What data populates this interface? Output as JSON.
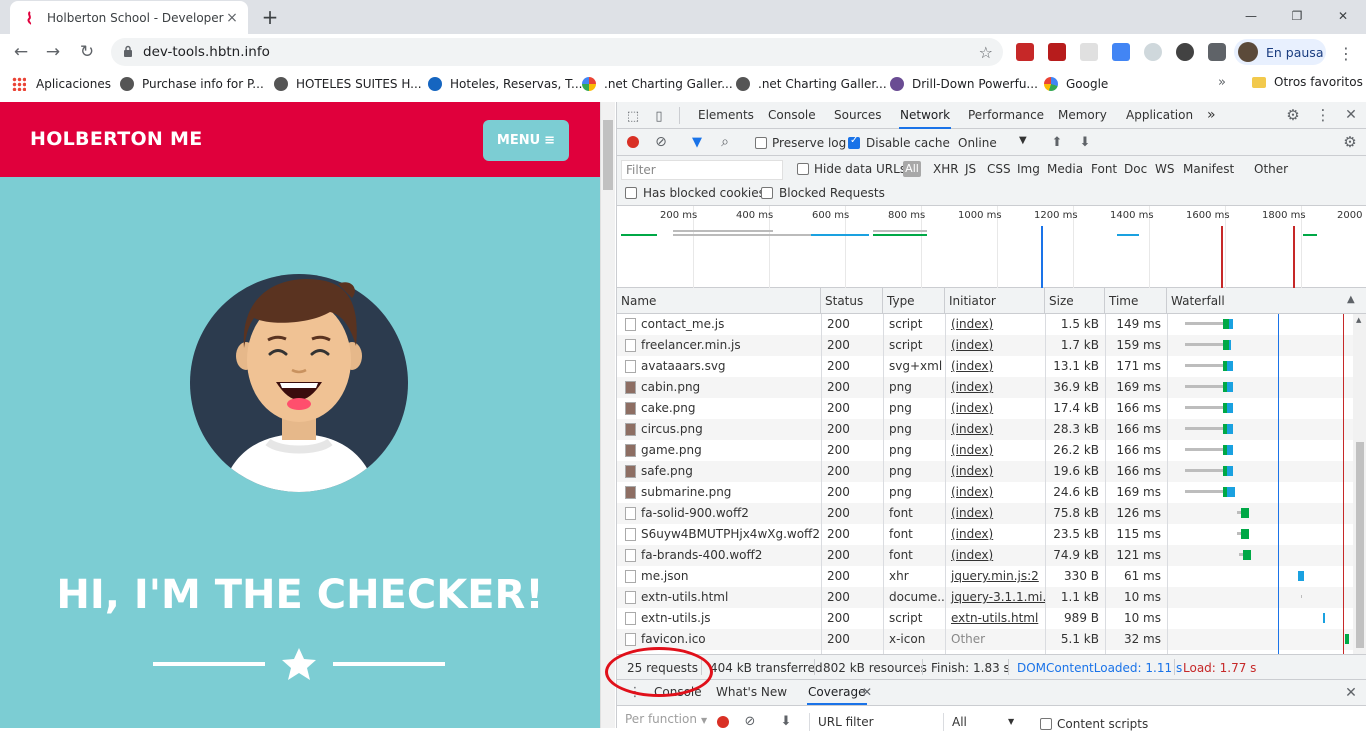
{
  "tab": {
    "title": "Holberton School - Developer tools",
    "close": "×",
    "new_tab": "+"
  },
  "window_controls": {
    "minimize": "—",
    "maximize": "❐",
    "close": "✕"
  },
  "address": {
    "url": "dev-tools.hbtn.info"
  },
  "profile": {
    "label": "En pausa"
  },
  "bookmarks": {
    "apps": "Aplicaciones",
    "items": [
      "Purchase info for P...",
      "HOTELES SUITES H...",
      "Hoteles, Reservas, T...",
      ".net Charting Galler...",
      ".net Charting Galler...",
      "Drill-Down Powerfu...",
      "Google"
    ],
    "more": "»",
    "other": "Otros favoritos"
  },
  "site": {
    "brand": "HOLBERTON ME",
    "menu": "MENU",
    "hero_title": "HI, I'M THE CHECKER!"
  },
  "devtools": {
    "tabs": [
      "Elements",
      "Console",
      "Sources",
      "Network",
      "Performance",
      "Memory",
      "Application"
    ],
    "active_tab": "Network",
    "more_tabs": "»",
    "toolbar": {
      "preserve_log": "Preserve log",
      "disable_cache": "Disable cache",
      "throttle": "Online"
    },
    "filter": {
      "placeholder": "Filter",
      "hide_data_urls": "Hide data URLs",
      "all": "All",
      "types": [
        "XHR",
        "JS",
        "CSS",
        "Img",
        "Media",
        "Font",
        "Doc",
        "WS",
        "Manifest",
        "Other"
      ],
      "blocked_cookies": "Has blocked cookies",
      "blocked_requests": "Blocked Requests"
    },
    "overview_ticks": [
      "200 ms",
      "400 ms",
      "600 ms",
      "800 ms",
      "1000 ms",
      "1200 ms",
      "1400 ms",
      "1600 ms",
      "1800 ms",
      "2000"
    ],
    "columns": [
      "Name",
      "Status",
      "Type",
      "Initiator",
      "Size",
      "Time",
      "Waterfall"
    ],
    "rows": [
      {
        "name": "contact_me.js",
        "status": "200",
        "type": "script",
        "initiator": "(index)",
        "size": "1.5 kB",
        "time": "149 ms"
      },
      {
        "name": "freelancer.min.js",
        "status": "200",
        "type": "script",
        "initiator": "(index)",
        "size": "1.7 kB",
        "time": "159 ms"
      },
      {
        "name": "avataaars.svg",
        "status": "200",
        "type": "svg+xml",
        "initiator": "(index)",
        "size": "13.1 kB",
        "time": "171 ms"
      },
      {
        "name": "cabin.png",
        "status": "200",
        "type": "png",
        "initiator": "(index)",
        "size": "36.9 kB",
        "time": "169 ms"
      },
      {
        "name": "cake.png",
        "status": "200",
        "type": "png",
        "initiator": "(index)",
        "size": "17.4 kB",
        "time": "166 ms"
      },
      {
        "name": "circus.png",
        "status": "200",
        "type": "png",
        "initiator": "(index)",
        "size": "28.3 kB",
        "time": "166 ms"
      },
      {
        "name": "game.png",
        "status": "200",
        "type": "png",
        "initiator": "(index)",
        "size": "26.2 kB",
        "time": "166 ms"
      },
      {
        "name": "safe.png",
        "status": "200",
        "type": "png",
        "initiator": "(index)",
        "size": "19.6 kB",
        "time": "166 ms"
      },
      {
        "name": "submarine.png",
        "status": "200",
        "type": "png",
        "initiator": "(index)",
        "size": "24.6 kB",
        "time": "169 ms"
      },
      {
        "name": "fa-solid-900.woff2",
        "status": "200",
        "type": "font",
        "initiator": "(index)",
        "size": "75.8 kB",
        "time": "126 ms"
      },
      {
        "name": "S6uyw4BMUTPHjx4wXg.woff2",
        "status": "200",
        "type": "font",
        "initiator": "(index)",
        "size": "23.5 kB",
        "time": "115 ms"
      },
      {
        "name": "fa-brands-400.woff2",
        "status": "200",
        "type": "font",
        "initiator": "(index)",
        "size": "74.9 kB",
        "time": "121 ms"
      },
      {
        "name": "me.json",
        "status": "200",
        "type": "xhr",
        "initiator": "jquery.min.js:2",
        "size": "330 B",
        "time": "61 ms"
      },
      {
        "name": "extn-utils.html",
        "status": "200",
        "type": "docume...",
        "initiator": "jquery-3.1.1.mi...",
        "size": "1.1 kB",
        "time": "10 ms"
      },
      {
        "name": "extn-utils.js",
        "status": "200",
        "type": "script",
        "initiator": "extn-utils.html",
        "size": "989 B",
        "time": "10 ms"
      },
      {
        "name": "favicon.ico",
        "status": "200",
        "type": "x-icon",
        "initiator": "Other",
        "size": "5.1 kB",
        "time": "32 ms"
      }
    ],
    "summary": {
      "requests": "25 requests",
      "transferred": "404 kB transferred",
      "resources": "802 kB resources",
      "finish": "Finish: 1.83 s",
      "dom_content_loaded": "DOMContentLoaded: 1.11 s",
      "load": "Load: 1.77 s"
    },
    "drawer": {
      "tabs": [
        "Console",
        "What's New",
        "Coverage"
      ],
      "active_tab": "Coverage",
      "per_function": "Per function",
      "url_filter": "URL filter",
      "all": "All",
      "content_scripts": "Content scripts"
    }
  },
  "colors": {
    "brand_red": "#e0003c",
    "teal": "#7ccdd3",
    "devtools_blue": "#1a73e8",
    "annotation": "#e0101a"
  }
}
